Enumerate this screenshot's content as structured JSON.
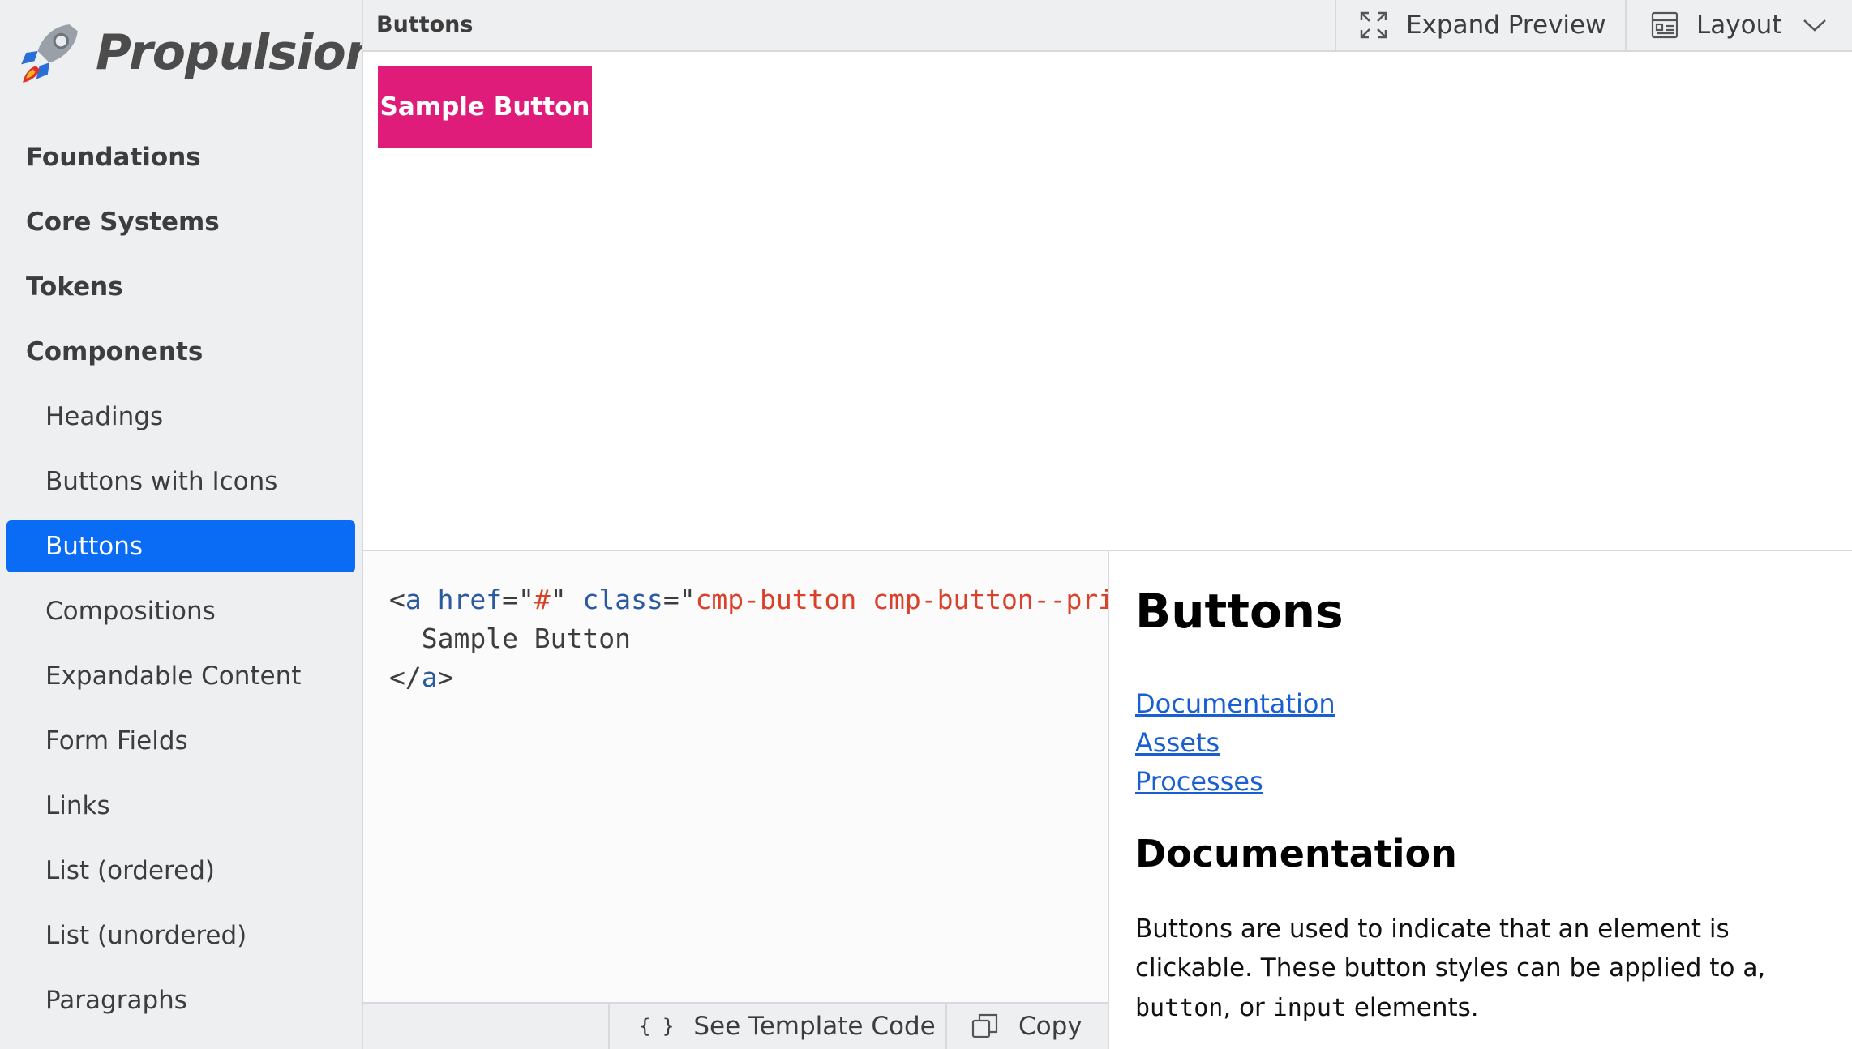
{
  "brand": {
    "name": "Propulsion"
  },
  "sidebar": {
    "items": [
      {
        "label": "Foundations",
        "level": "top"
      },
      {
        "label": "Core Systems",
        "level": "top"
      },
      {
        "label": "Tokens",
        "level": "top"
      },
      {
        "label": "Components",
        "level": "top"
      },
      {
        "label": "Headings",
        "level": "sub"
      },
      {
        "label": "Buttons with Icons",
        "level": "sub"
      },
      {
        "label": "Buttons",
        "level": "sub",
        "active": true
      },
      {
        "label": "Compositions",
        "level": "sub"
      },
      {
        "label": "Expandable Content",
        "level": "sub"
      },
      {
        "label": "Form Fields",
        "level": "sub"
      },
      {
        "label": "Links",
        "level": "sub"
      },
      {
        "label": "List (ordered)",
        "level": "sub"
      },
      {
        "label": "List (unordered)",
        "level": "sub"
      },
      {
        "label": "Paragraphs",
        "level": "sub"
      }
    ]
  },
  "toolbar": {
    "title": "Buttons",
    "expand_label": "Expand Preview",
    "layout_label": "Layout"
  },
  "preview": {
    "sample_button_label": "Sample Button"
  },
  "code": {
    "line1_open": "<",
    "line1_tag": "a",
    "line1_href_attr": " href",
    "line1_eq1": "=",
    "line1_href_q1": "\"",
    "line1_href_val": "#",
    "line1_href_q2": "\"",
    "line1_class_attr": " class",
    "line1_eq2": "=",
    "line1_class_q1": "\"",
    "line1_class_val": "cmp-button cmp-button--prim",
    "line2": "  Sample Button",
    "line3_open": "</",
    "line3_tag": "a",
    "line3_close": ">"
  },
  "code_footer": {
    "template_icon": "{ }",
    "template_label": "See Template Code",
    "copy_label": "Copy"
  },
  "docs": {
    "title": "Buttons",
    "links": [
      "Documentation",
      "Assets",
      "Processes"
    ],
    "section_heading": "Documentation",
    "para_text1": "Buttons are used to indicate that an element is clickable. These button styles can be applied to ",
    "para_code1": "a",
    "para_text2": ", ",
    "para_code2": "button",
    "para_text3": ", or ",
    "para_code3": "input",
    "para_text4": " elements."
  },
  "colors": {
    "accent": "#0a6bf5",
    "sample_button": "#e01c7a",
    "link": "#1a5fd1"
  }
}
